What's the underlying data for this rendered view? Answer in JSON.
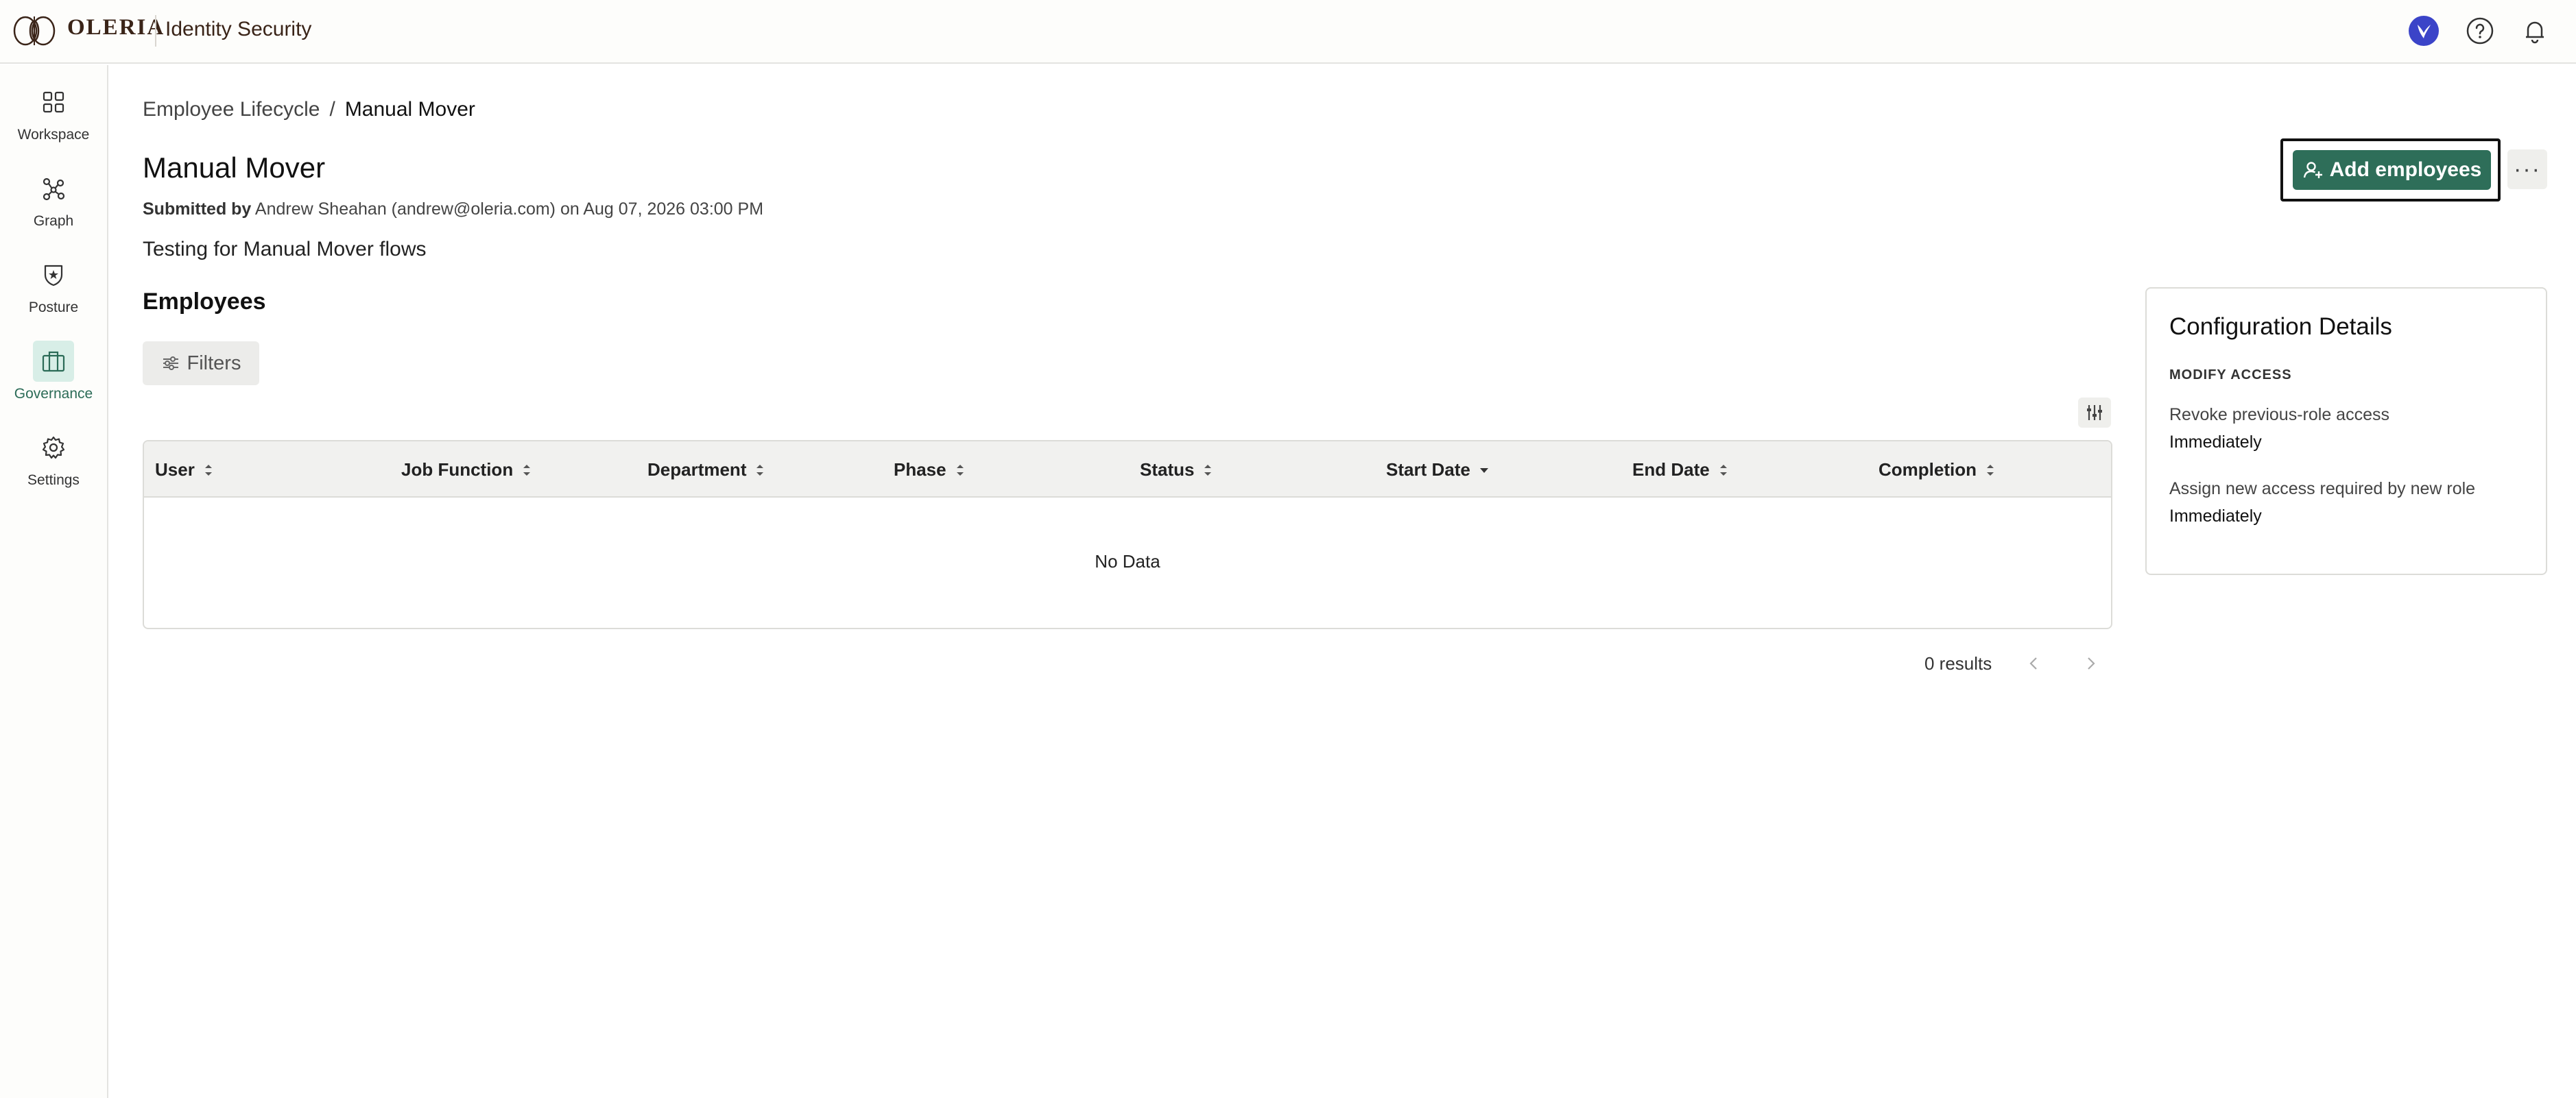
{
  "app": {
    "brand": "OLERIA",
    "product": "Identity Security"
  },
  "header_icons": [
    "user-avatar-icon",
    "help-icon",
    "bell-icon"
  ],
  "sidebar": {
    "items": [
      {
        "label": "Workspace",
        "icon": "grid-icon"
      },
      {
        "label": "Graph",
        "icon": "graph-icon"
      },
      {
        "label": "Posture",
        "icon": "shield-icon"
      },
      {
        "label": "Governance",
        "icon": "briefcase-icon",
        "active": true
      },
      {
        "label": "Settings",
        "icon": "gear-icon"
      }
    ]
  },
  "breadcrumb": {
    "parent": "Employee Lifecycle",
    "separator": "/",
    "current": "Manual Mover"
  },
  "page": {
    "title": "Manual Mover",
    "submitted_prefix": "Submitted by",
    "submitted_text": " Andrew Sheahan (andrew@oleria.com) on Aug 07, 2026 03:00 PM",
    "description": "Testing for Manual Mover flows",
    "add_employees_label": "Add employees",
    "more_label": "···"
  },
  "employees": {
    "title": "Employees",
    "filters_label": "Filters",
    "columns": [
      "User",
      "Job Function",
      "Department",
      "Phase",
      "Status",
      "Start Date",
      "End Date",
      "Completion"
    ],
    "sorted_column": "Start Date",
    "empty_text": "No Data",
    "results_text": "0 results"
  },
  "config": {
    "title": "Configuration Details",
    "subtitle": "MODIFY ACCESS",
    "items": [
      {
        "label": "Revoke previous-role access",
        "value": "Immediately"
      },
      {
        "label": "Assign new access required by new role",
        "value": "Immediately"
      }
    ]
  },
  "colors": {
    "primary": "#2e6e59",
    "active_bg": "#d8eee7",
    "brand_text": "#3a2418",
    "avatar": "#3b44c8"
  }
}
